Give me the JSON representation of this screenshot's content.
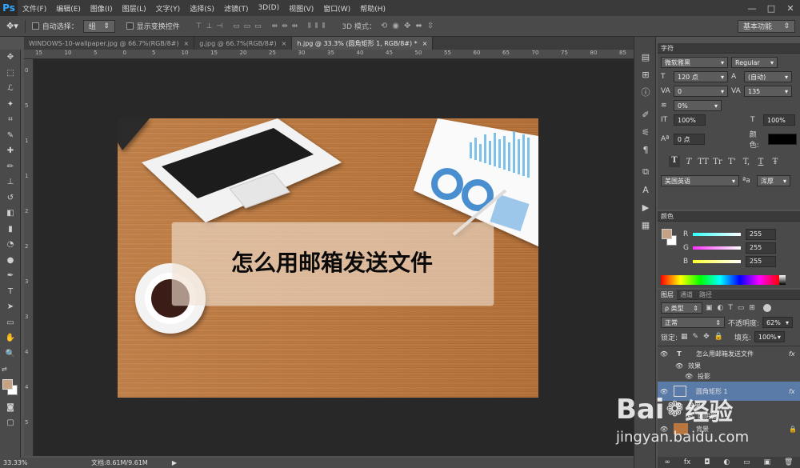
{
  "app": {
    "logo": "Ps"
  },
  "menu": [
    "文件(F)",
    "编辑(E)",
    "图像(I)",
    "图层(L)",
    "文字(Y)",
    "选择(S)",
    "滤镜(T)",
    "3D(D)",
    "视图(V)",
    "窗口(W)",
    "帮助(H)"
  ],
  "window_controls": {
    "minimize": "—",
    "restore": "□",
    "close": "✕"
  },
  "options": {
    "auto_select_label": "自动选择：",
    "auto_select_value": "组",
    "show_transform_label": "显示变换控件",
    "mode_3d_label": "3D 模式：",
    "workspace": "基本功能"
  },
  "tabs": [
    {
      "label": "WINDOWS-10-wallpaper.jpg @ 66.7%(RGB/8#)",
      "close": "×"
    },
    {
      "label": "g.jpg @ 66.7%(RGB/8#)",
      "close": "×"
    },
    {
      "label": "h.jpg @ 33.3% (圆角矩形 1, RGB/8#) *",
      "close": "×"
    }
  ],
  "ruler_h": [
    "15",
    "10",
    "5",
    "0",
    "5",
    "10",
    "15",
    "20",
    "25",
    "30",
    "35",
    "40",
    "45",
    "50",
    "55",
    "60",
    "65",
    "70",
    "75",
    "80",
    "85"
  ],
  "ruler_v": [
    "0",
    "5",
    "1",
    "1",
    "2",
    "2",
    "3",
    "3",
    "4",
    "4",
    "5"
  ],
  "canvas": {
    "headline": "怎么用邮箱发送文件"
  },
  "status": {
    "zoom": "33.33%",
    "doc": "文档:8.61M/9.61M",
    "arrow": "▶"
  },
  "character": {
    "title": "字符",
    "font": "微软雅黑",
    "style": "Regular",
    "size": "120 点",
    "leading": "(自动)",
    "kerning": "0",
    "tracking": "135",
    "scale_pct": "0%",
    "vscale": "100%",
    "hscale": "100%",
    "baseline": "0 点",
    "color_label": "颜色:",
    "color_value": "#000000",
    "styles": [
      "T",
      "T",
      "TT",
      "Tr",
      "T'",
      "T,",
      "T",
      "Ŧ"
    ],
    "language": "美国英语",
    "aa_label": "ªa",
    "aa_value": "浑厚"
  },
  "color_panel": {
    "title": "颜色",
    "channels": [
      {
        "label": "R",
        "value": "255",
        "color": "#e35c5c"
      },
      {
        "label": "G",
        "value": "255",
        "color": "#7cc24f"
      },
      {
        "label": "B",
        "value": "255",
        "color": "#5a8de0"
      }
    ],
    "fg": "#c4a283",
    "bg": "#ffffff"
  },
  "layers": {
    "tabs": [
      "图层",
      "通道",
      "路径"
    ],
    "filter_label": "ρ 类型",
    "blend": "正常",
    "opacity_label": "不透明度:",
    "opacity": "62%",
    "lock_label": "锁定:",
    "fill_label": "填充:",
    "fill": "100%",
    "items": [
      {
        "name": "怎么用邮箱发送文件",
        "type": "T",
        "fx": "fx",
        "indent": 0
      },
      {
        "name": "效果",
        "type": "",
        "fx": "",
        "indent": 1
      },
      {
        "name": "投影",
        "type": "",
        "fx": "",
        "indent": 2
      },
      {
        "name": "圆角矩形 1",
        "type": "rect",
        "fx": "fx",
        "indent": 0,
        "selected": true
      },
      {
        "name": "效果",
        "type": "",
        "fx": "",
        "indent": 1
      },
      {
        "name": "内阴影",
        "type": "",
        "fx": "",
        "indent": 2
      },
      {
        "name": "背景",
        "type": "bg",
        "fx": "",
        "indent": 0
      }
    ],
    "footer": [
      "∞",
      "fx",
      "◘",
      "◐",
      "▭",
      "▣",
      "🗑"
    ]
  },
  "watermark": {
    "brand": "Bai",
    "brand2": "经验",
    "url": "jingyan.baidu.com"
  }
}
